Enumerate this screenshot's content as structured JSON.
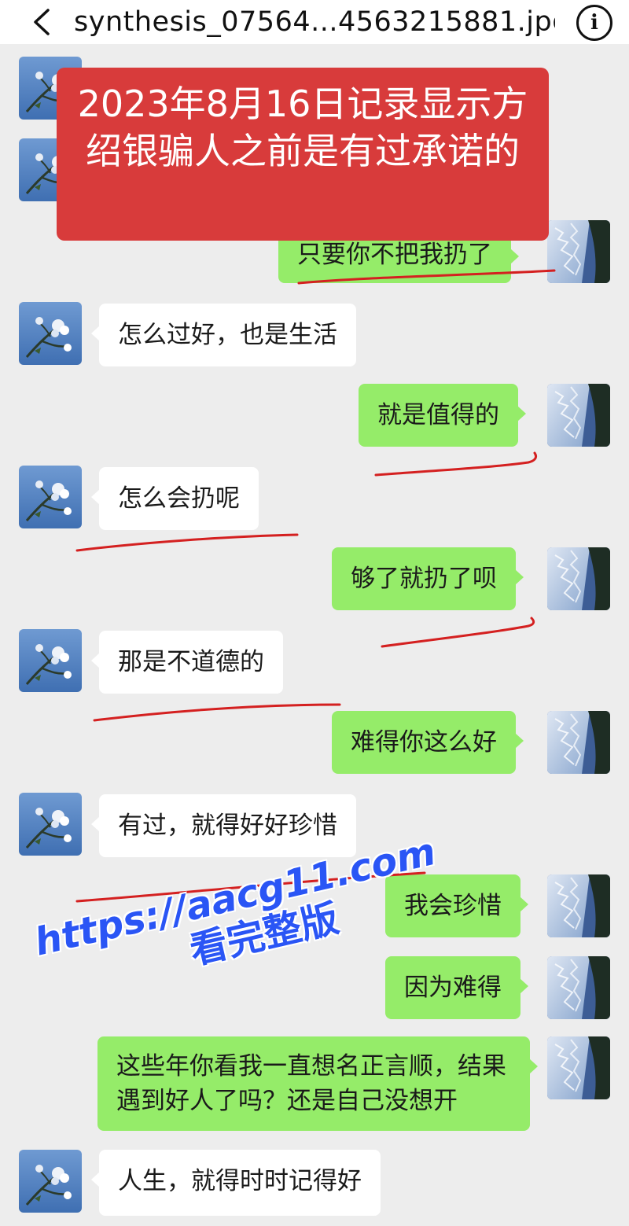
{
  "topbar": {
    "back_icon": "chevron-left-icon",
    "file_name": "synthesis_07564...4563215881.jpg",
    "info_icon": "info-icon",
    "info_glyph": "i"
  },
  "banner": {
    "text": "2023年8月16日记录显示方绍银骗人之前是有过承诺的"
  },
  "messages": [
    {
      "side": "out",
      "text": "只要你不把我扔了"
    },
    {
      "side": "in",
      "text": "怎么过好，也是生活"
    },
    {
      "side": "out",
      "text": "就是值得的"
    },
    {
      "side": "in",
      "text": "怎么会扔呢"
    },
    {
      "side": "out",
      "text": "够了就扔了呗"
    },
    {
      "side": "in",
      "text": "那是不道德的"
    },
    {
      "side": "out",
      "text": "难得你这么好"
    },
    {
      "side": "in",
      "text": "有过，就得好好珍惜"
    },
    {
      "side": "out",
      "text": "我会珍惜"
    },
    {
      "side": "out",
      "text": "因为难得"
    },
    {
      "side": "out",
      "text": "这些年你看我一直想名正言顺，结果遇到好人了吗？还是自己没想开"
    },
    {
      "side": "in",
      "text": "人生，就得时时记得好"
    }
  ],
  "watermark": {
    "url": "https://aacg11.com",
    "subtitle": "看完整版"
  },
  "colors": {
    "background": "#ededed",
    "bubble_out": "#95ec69",
    "bubble_in": "#ffffff",
    "banner": "#d83b3b",
    "underline": "#d42020",
    "watermark": "#2a55f5"
  }
}
